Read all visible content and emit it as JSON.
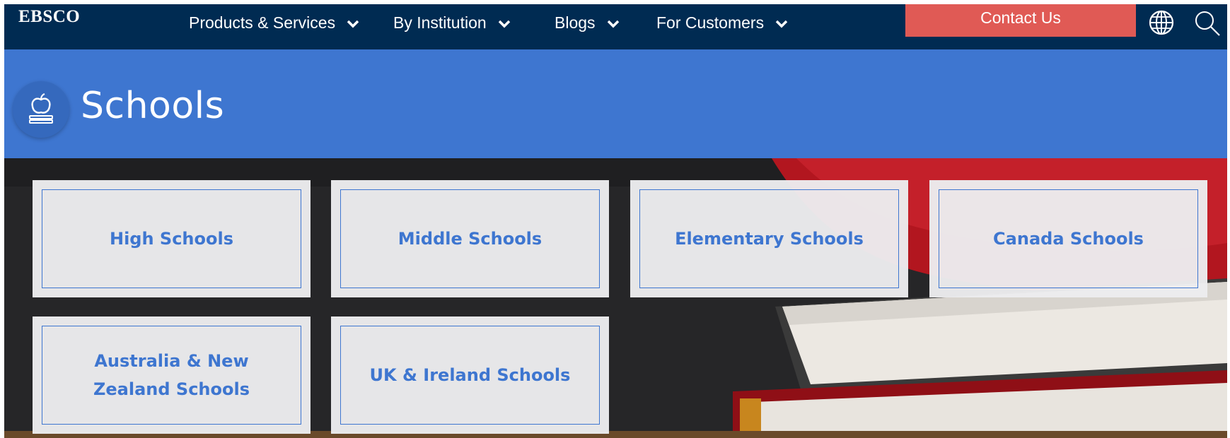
{
  "nav": {
    "logo": "EBSCO",
    "items": [
      {
        "label": "Products & Services"
      },
      {
        "label": "By Institution"
      },
      {
        "label": "Blogs"
      },
      {
        "label": "For Customers"
      }
    ],
    "contact_label": "Contact Us",
    "icons": [
      "globe-icon",
      "search-icon"
    ]
  },
  "band": {
    "title": "Schools",
    "icon": "apple-books-icon"
  },
  "cards": [
    {
      "label": "High Schools"
    },
    {
      "label": "Middle Schools"
    },
    {
      "label": "Elementary Schools"
    },
    {
      "label": "Canada Schools"
    },
    {
      "label": "Australia & New Zealand Schools"
    },
    {
      "label": "UK & Ireland Schools"
    }
  ],
  "colors": {
    "nav_bg": "#002b52",
    "band_bg": "#3e76d0",
    "accent": "#3e76d0",
    "contact_bg": "#e05a55"
  }
}
